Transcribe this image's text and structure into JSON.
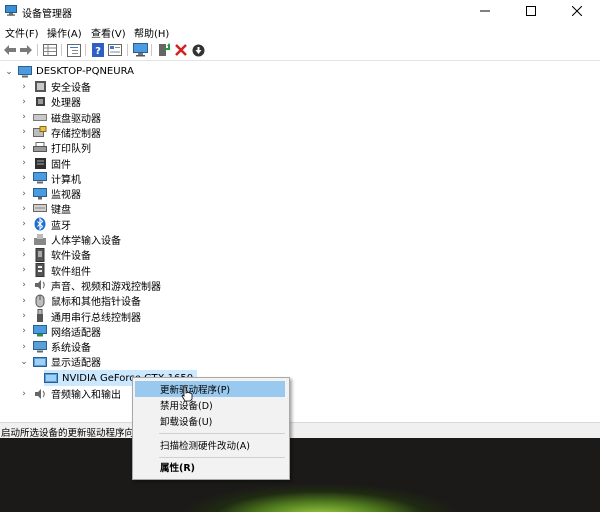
{
  "window": {
    "title": "设备管理器",
    "controls": {
      "minimize": "minimize",
      "maximize": "maximize",
      "close": "close"
    }
  },
  "menu": [
    "文件(F)",
    "操作(A)",
    "查看(V)",
    "帮助(H)"
  ],
  "toolbar": [
    "back-arrow",
    "forward-arrow",
    "properties",
    "tree-view",
    "help",
    "details-view",
    "monitor-scan",
    "update-driver",
    "uninstall",
    "disable"
  ],
  "tree": {
    "root": "DESKTOP-PQNEURA",
    "categories": [
      {
        "label": "安全设备",
        "icon": "security-device-icon"
      },
      {
        "label": "处理器",
        "icon": "processor-icon"
      },
      {
        "label": "磁盘驱动器",
        "icon": "disk-drive-icon"
      },
      {
        "label": "存储控制器",
        "icon": "storage-controller-icon"
      },
      {
        "label": "打印队列",
        "icon": "printer-icon"
      },
      {
        "label": "固件",
        "icon": "firmware-icon"
      },
      {
        "label": "计算机",
        "icon": "computer-icon"
      },
      {
        "label": "监视器",
        "icon": "monitor-icon"
      },
      {
        "label": "键盘",
        "icon": "keyboard-icon"
      },
      {
        "label": "蓝牙",
        "icon": "bluetooth-icon"
      },
      {
        "label": "人体学输入设备",
        "icon": "hid-icon"
      },
      {
        "label": "软件设备",
        "icon": "software-device-icon"
      },
      {
        "label": "软件组件",
        "icon": "software-component-icon"
      },
      {
        "label": "声音、视频和游戏控制器",
        "icon": "audio-video-icon"
      },
      {
        "label": "鼠标和其他指针设备",
        "icon": "mouse-icon"
      },
      {
        "label": "通用串行总线控制器",
        "icon": "usb-icon"
      },
      {
        "label": "网络适配器",
        "icon": "network-adapter-icon"
      },
      {
        "label": "系统设备",
        "icon": "system-device-icon"
      },
      {
        "label": "显示适配器",
        "icon": "display-adapter-icon"
      }
    ],
    "display_child": "NVIDIA GeForce GTX 1650",
    "last_category": "音频输入和输出"
  },
  "status": "启动所选设备的更新驱动程序向导。",
  "context_menu": {
    "items": [
      "更新驱动程序(P)",
      "禁用设备(D)",
      "卸载设备(U)",
      "扫描检测硬件改动(A)",
      "属性(R)"
    ],
    "highlighted": 0
  },
  "colors": {
    "selection": "#cce8ff",
    "menu_highlight": "#99c9ef",
    "accent": "#0078d7"
  }
}
